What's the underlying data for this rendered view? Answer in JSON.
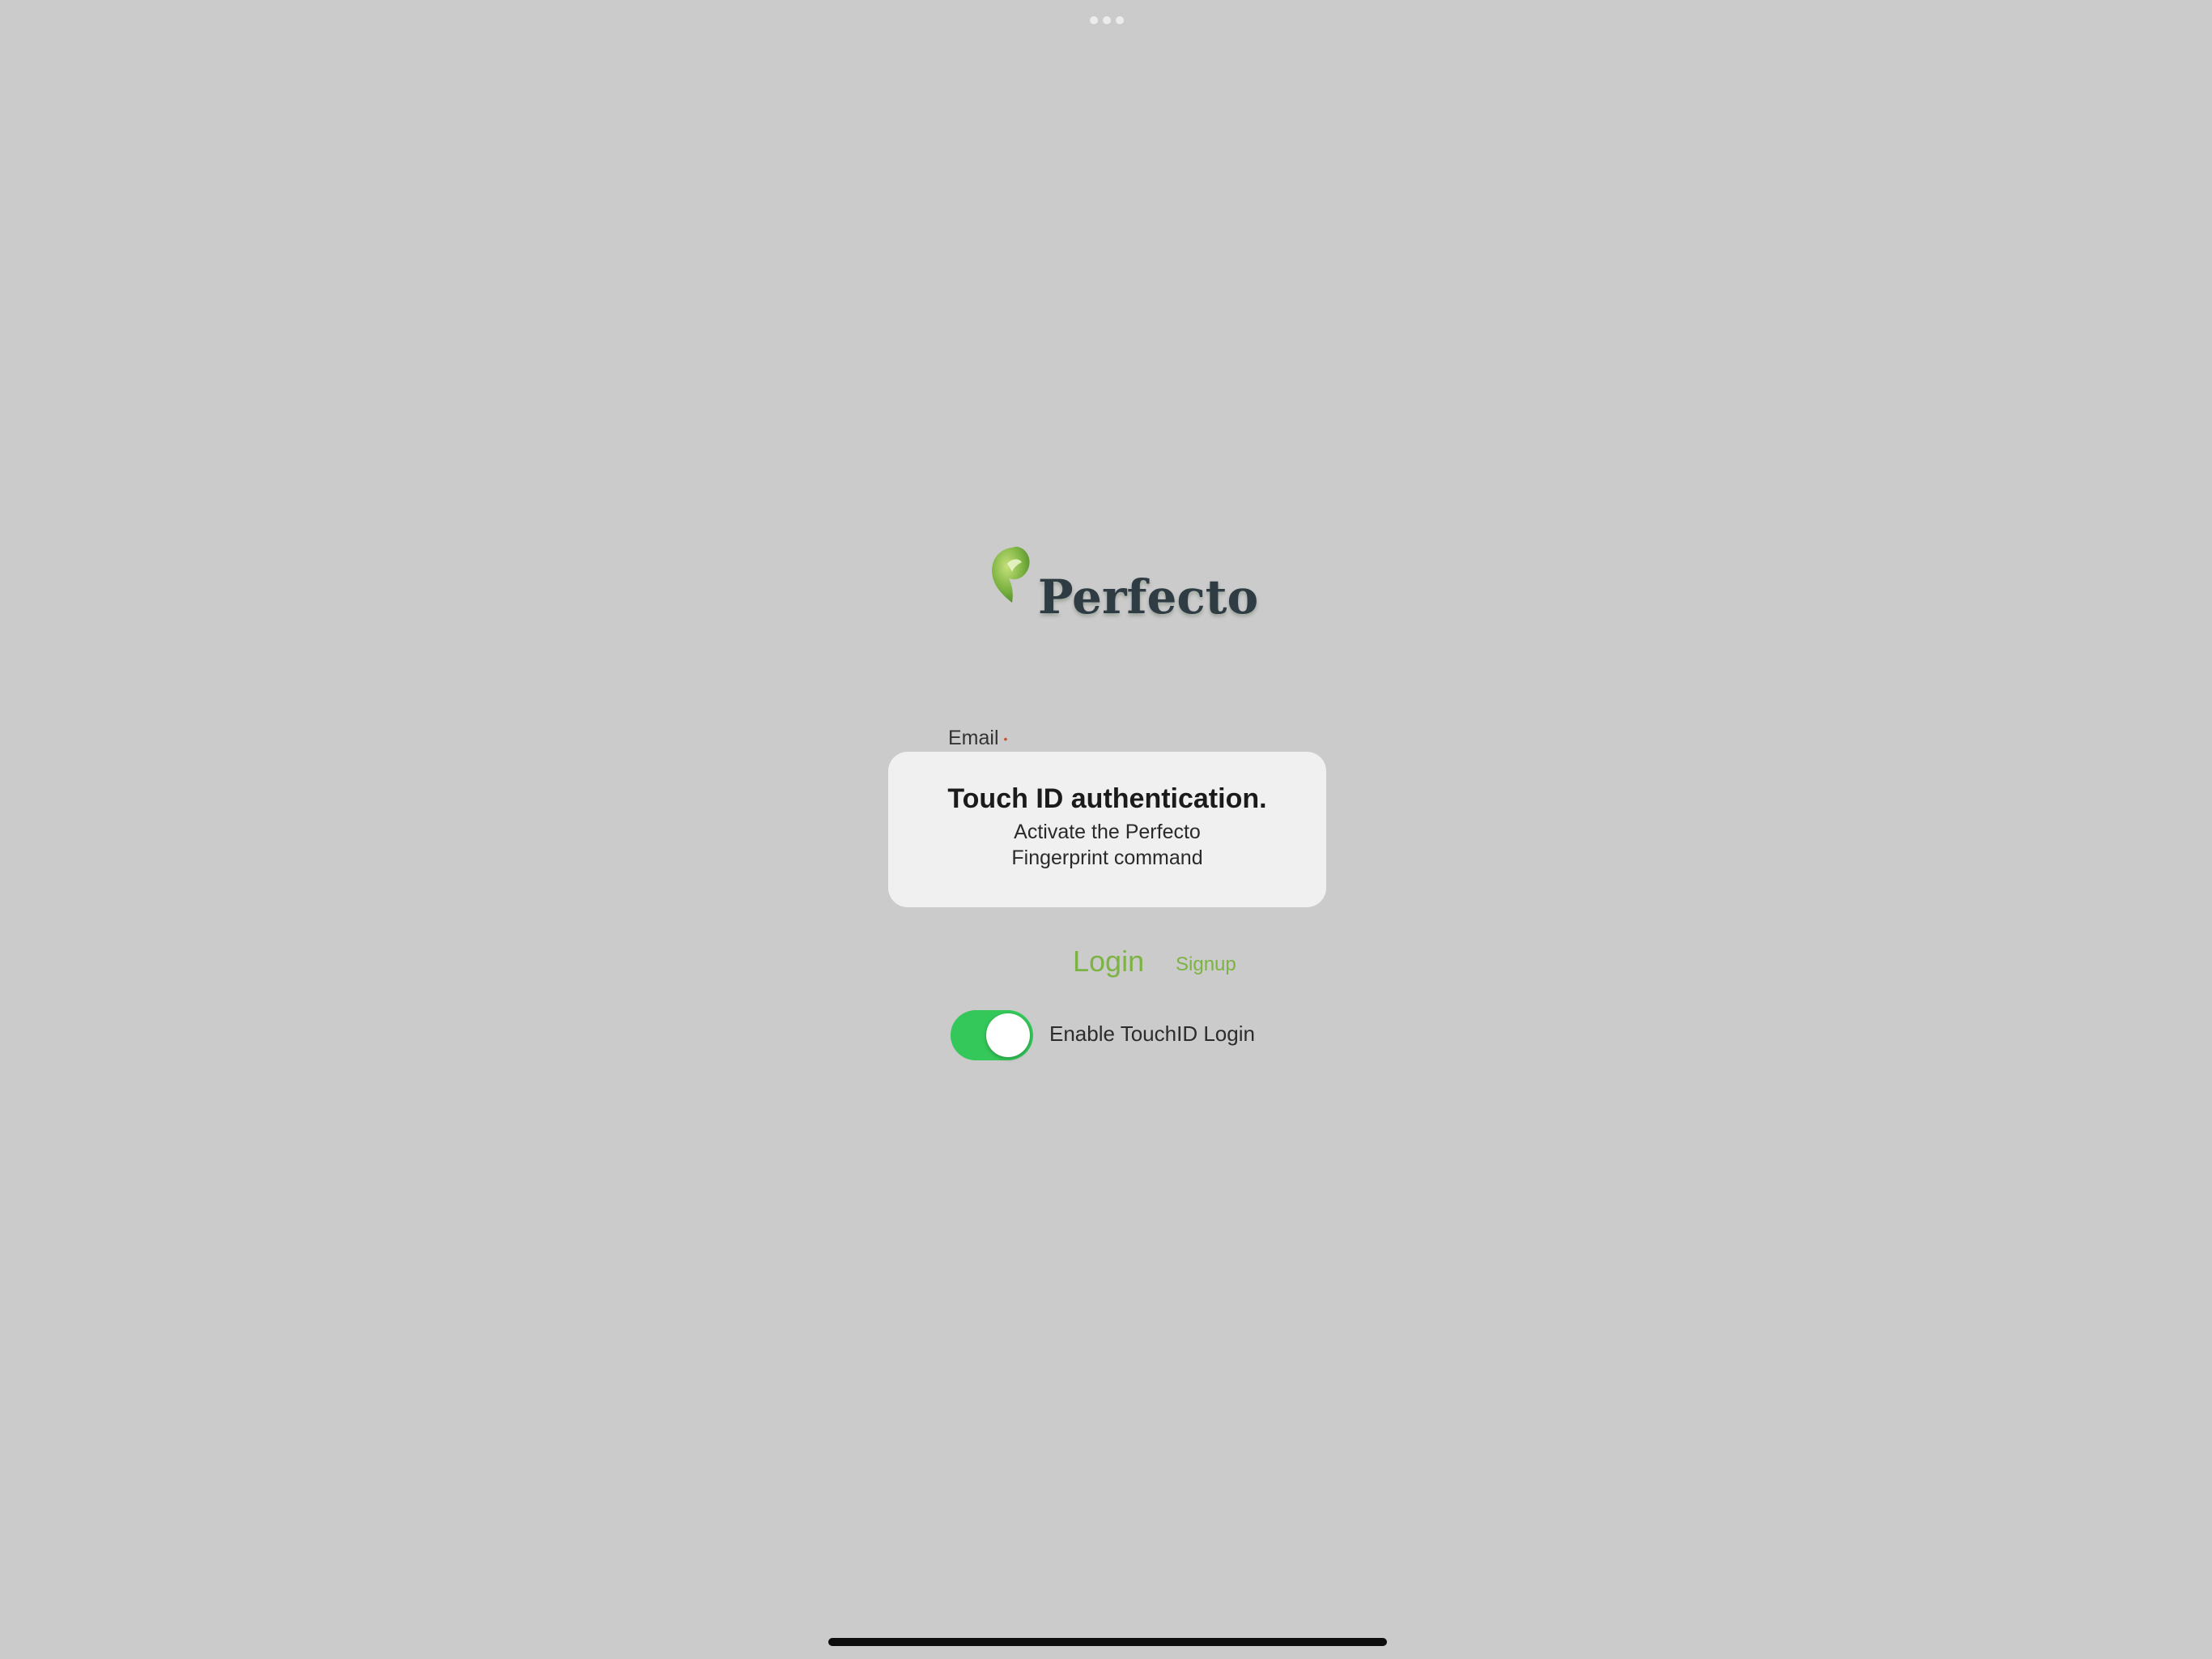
{
  "app": {
    "brand_name": "Perfecto"
  },
  "login_form": {
    "email_label": "Email",
    "required_marker": "•",
    "login_label": "Login",
    "signup_label": "Signup",
    "touchid_toggle_label": "Enable TouchID Login",
    "touchid_toggle_on": true
  },
  "alert": {
    "title": "Touch ID authentication.",
    "message": "Activate the Perfecto\nFingerprint command"
  },
  "colors": {
    "background": "#cbcbcb",
    "accent_green": "#7cb342",
    "toggle_on": "#34c759",
    "logo_text": "#303c43",
    "required": "#c9552c"
  },
  "icons": {
    "logo": "perfecto-leaf-logo-icon",
    "multitasking": "multitasking-dots-icon"
  }
}
